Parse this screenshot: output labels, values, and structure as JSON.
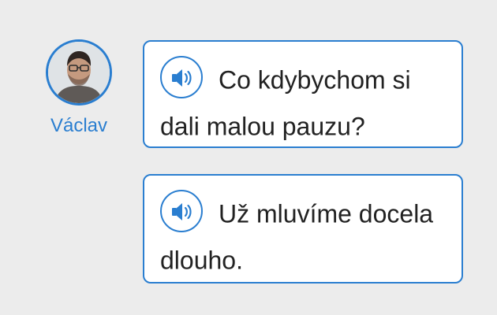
{
  "speaker": {
    "name": "Václav"
  },
  "messages": [
    {
      "text": "Co kdybychom si dali malou pauzu?",
      "audio_icon": "speaker-icon"
    },
    {
      "text": "Už mluvíme docela dlouho.",
      "audio_icon": "speaker-icon"
    }
  ],
  "colors": {
    "accent": "#2a7ed0",
    "background": "#ececec",
    "bubble_fill": "#ffffff",
    "text": "#222222"
  }
}
